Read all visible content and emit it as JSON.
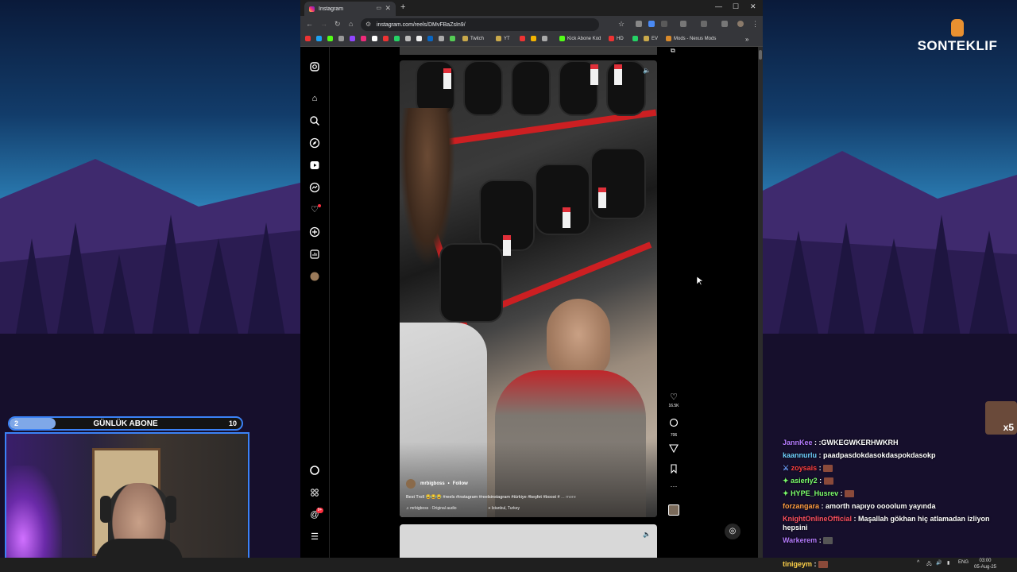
{
  "stream_overlay": {
    "logo_text": "SONTEKLIF",
    "sub_goal": {
      "current": "2",
      "label": "GÜNLÜK ABONE",
      "goal": "10",
      "progress": 0.2
    },
    "emote_badge": "x5"
  },
  "browser": {
    "tab_title": "Instagram",
    "url": "instagram.com/reels/DMvFBaZsIn9/",
    "bookmarks": [
      "Twitch",
      "YT",
      "Kick Abone Kod",
      "HD",
      "EV",
      "Mods - Nexus Mods"
    ]
  },
  "reel": {
    "author": "mrbigboss",
    "follow_label": "Follow",
    "caption": "Best Troll 😂😂😂 #reels #instagram #reelsinstagram #türkiye #keşfet #boost #",
    "more_label": "... more",
    "audio": "mrbigboss · Original audio",
    "location": "Istanbul, Turkey",
    "likes": "16.5K",
    "comments": "706"
  },
  "sidebar": {
    "notification_badge": "9+"
  },
  "chat": [
    {
      "user": "JannKee",
      "color": "#b57bff",
      "text": ":GWKEGWKERHWKRH",
      "badge": ""
    },
    {
      "user": "kaannurlu",
      "color": "#6fd0ff",
      "text": "paadpasdokdasokdaspokdasokp",
      "badge": ""
    },
    {
      "user": "zoysais",
      "color": "#ff4040",
      "text": "",
      "badge": "sword",
      "emote": true
    },
    {
      "user": "asierly2",
      "color": "#7cff6b",
      "text": "",
      "badge": "gem",
      "emote": true
    },
    {
      "user": "HYPE_Husrev",
      "color": "#7cff6b",
      "text": "",
      "badge": "gem",
      "emote": true
    },
    {
      "user": "forzangara",
      "color": "#ff9c40",
      "text": "amorth napıyo oooolum yayında",
      "badge": ""
    },
    {
      "user": "KnightOnlineOfficial",
      "color": "#ff5060",
      "text": "Maşallah gökhan hiç atlamadan izliyon hepsini",
      "badge": ""
    },
    {
      "user": "Warkerem",
      "color": "#b57bff",
      "text": "",
      "badge": "",
      "emote": true
    },
    {
      "user": "tinigeym",
      "color": "#ffd24a",
      "text": "",
      "badge": "",
      "emote": true
    }
  ],
  "taskbar": {
    "lang": "ENG",
    "time": "03:00",
    "date": "05-Aug-25"
  }
}
